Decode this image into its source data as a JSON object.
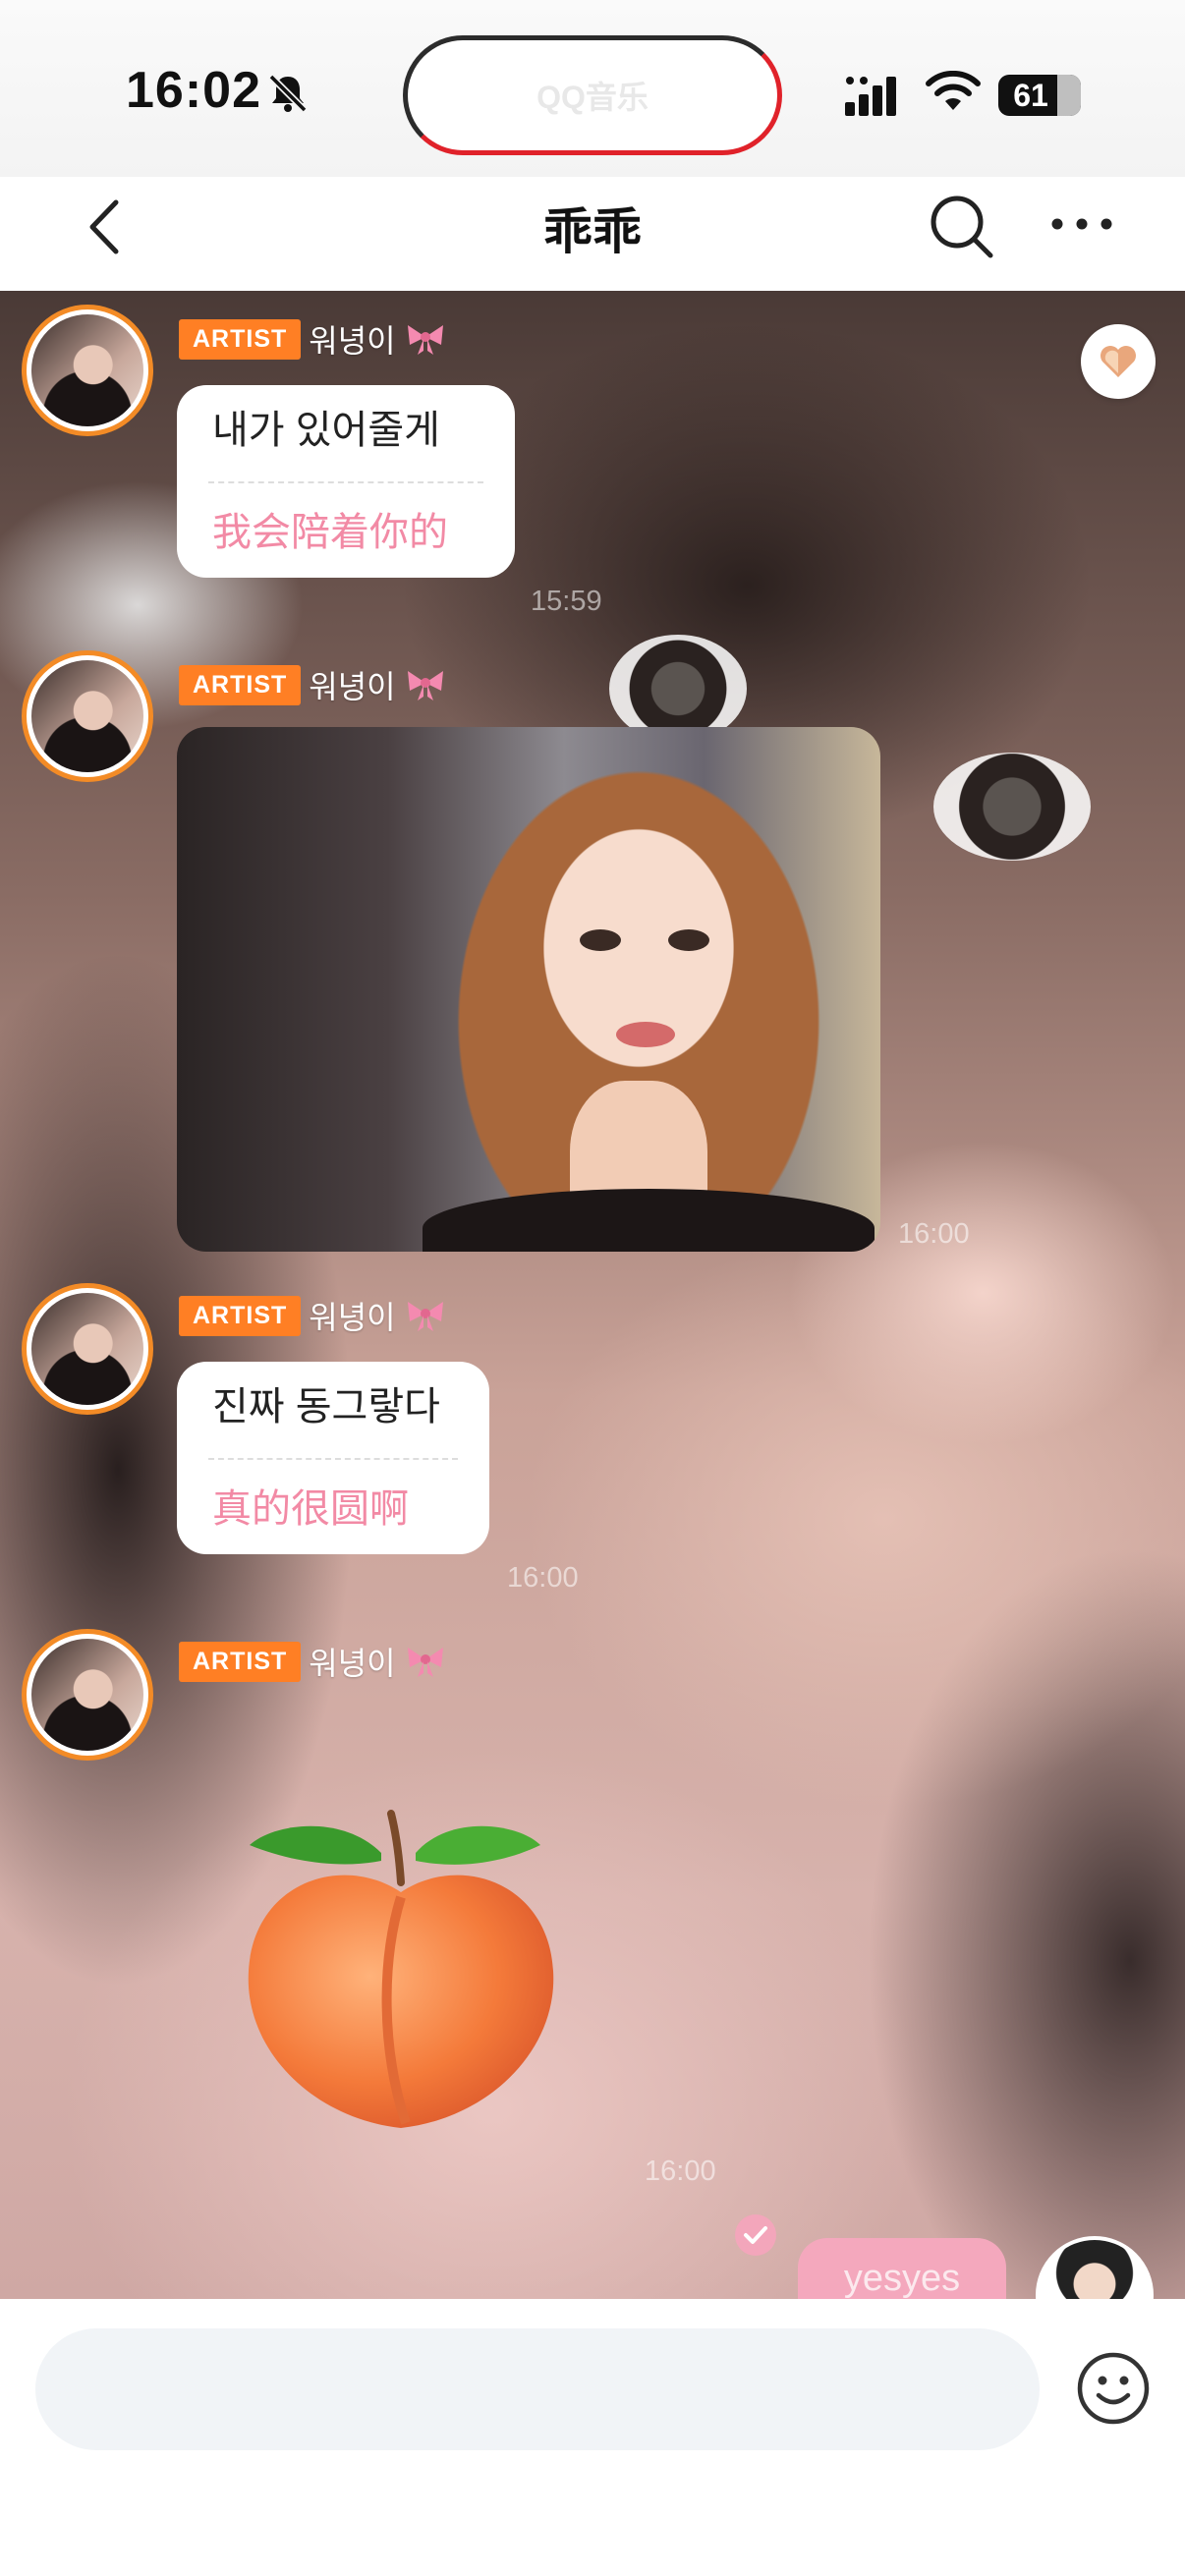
{
  "status_bar": {
    "time": "16:02",
    "island_label": "QQ音乐",
    "battery": "61",
    "icons": [
      "bell-slash-icon",
      "signal-icon",
      "wifi-icon",
      "battery-icon"
    ]
  },
  "nav": {
    "title": "乖乖",
    "icons": [
      "back-chevron-icon",
      "search-icon",
      "more-dots-icon"
    ]
  },
  "messages": [
    {
      "badge": "ARTIST",
      "sender": "워녕이",
      "text": "내가 있어줄게",
      "translation": "我会陪着你的",
      "time": "15:59"
    },
    {
      "badge": "ARTIST",
      "sender": "워녕이",
      "type": "image",
      "time": "16:00"
    },
    {
      "badge": "ARTIST",
      "sender": "워녕이",
      "text": "진짜 동그랗다",
      "translation": "真的很圆啊",
      "time": "16:00"
    },
    {
      "badge": "ARTIST",
      "sender": "워녕이",
      "type": "emoji",
      "emoji": "peach",
      "time": "16:00"
    }
  ],
  "my_message": {
    "text": "yesyes"
  },
  "input": {
    "placeholder": "",
    "value": ""
  },
  "colors": {
    "artist_badge": "#ff7f24",
    "avatar_ring": "#f38b26",
    "translation_text": "#f28aa5",
    "my_bubble": "#f4a8bd",
    "input_bg": "#f1f4f7"
  }
}
